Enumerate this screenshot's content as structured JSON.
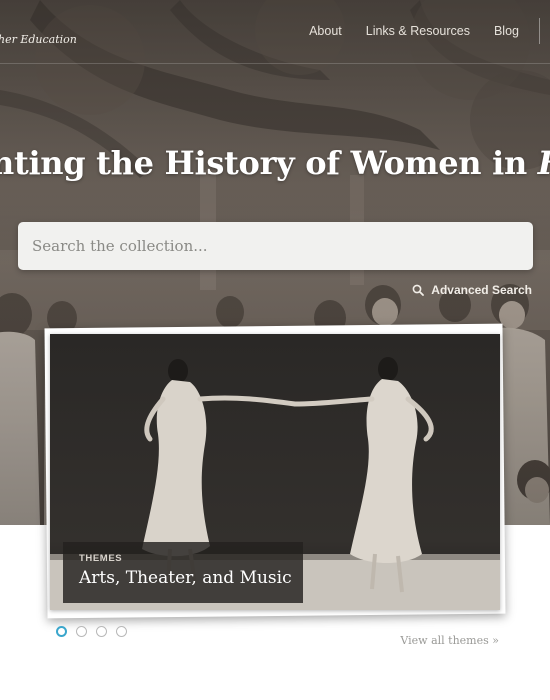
{
  "header": {
    "site_title_fragment": "her Education",
    "nav": [
      {
        "label": "About"
      },
      {
        "label": "Links & Resources"
      },
      {
        "label": "Blog"
      }
    ]
  },
  "hero": {
    "headline_regular": "nting the History of Women in ",
    "headline_italic": "Higher E"
  },
  "search": {
    "placeholder": "Search the collection...",
    "advanced_label": "Advanced Search"
  },
  "feature": {
    "kicker": "THEMES",
    "title": "Arts, Theater, and Music"
  },
  "pager": {
    "count": 4,
    "active_index": 0,
    "view_all_label": "View all themes »"
  },
  "colors": {
    "accent": "#3aa6cc",
    "hero_overlay": "#5b534c",
    "search_bg": "#f1f1ef"
  }
}
